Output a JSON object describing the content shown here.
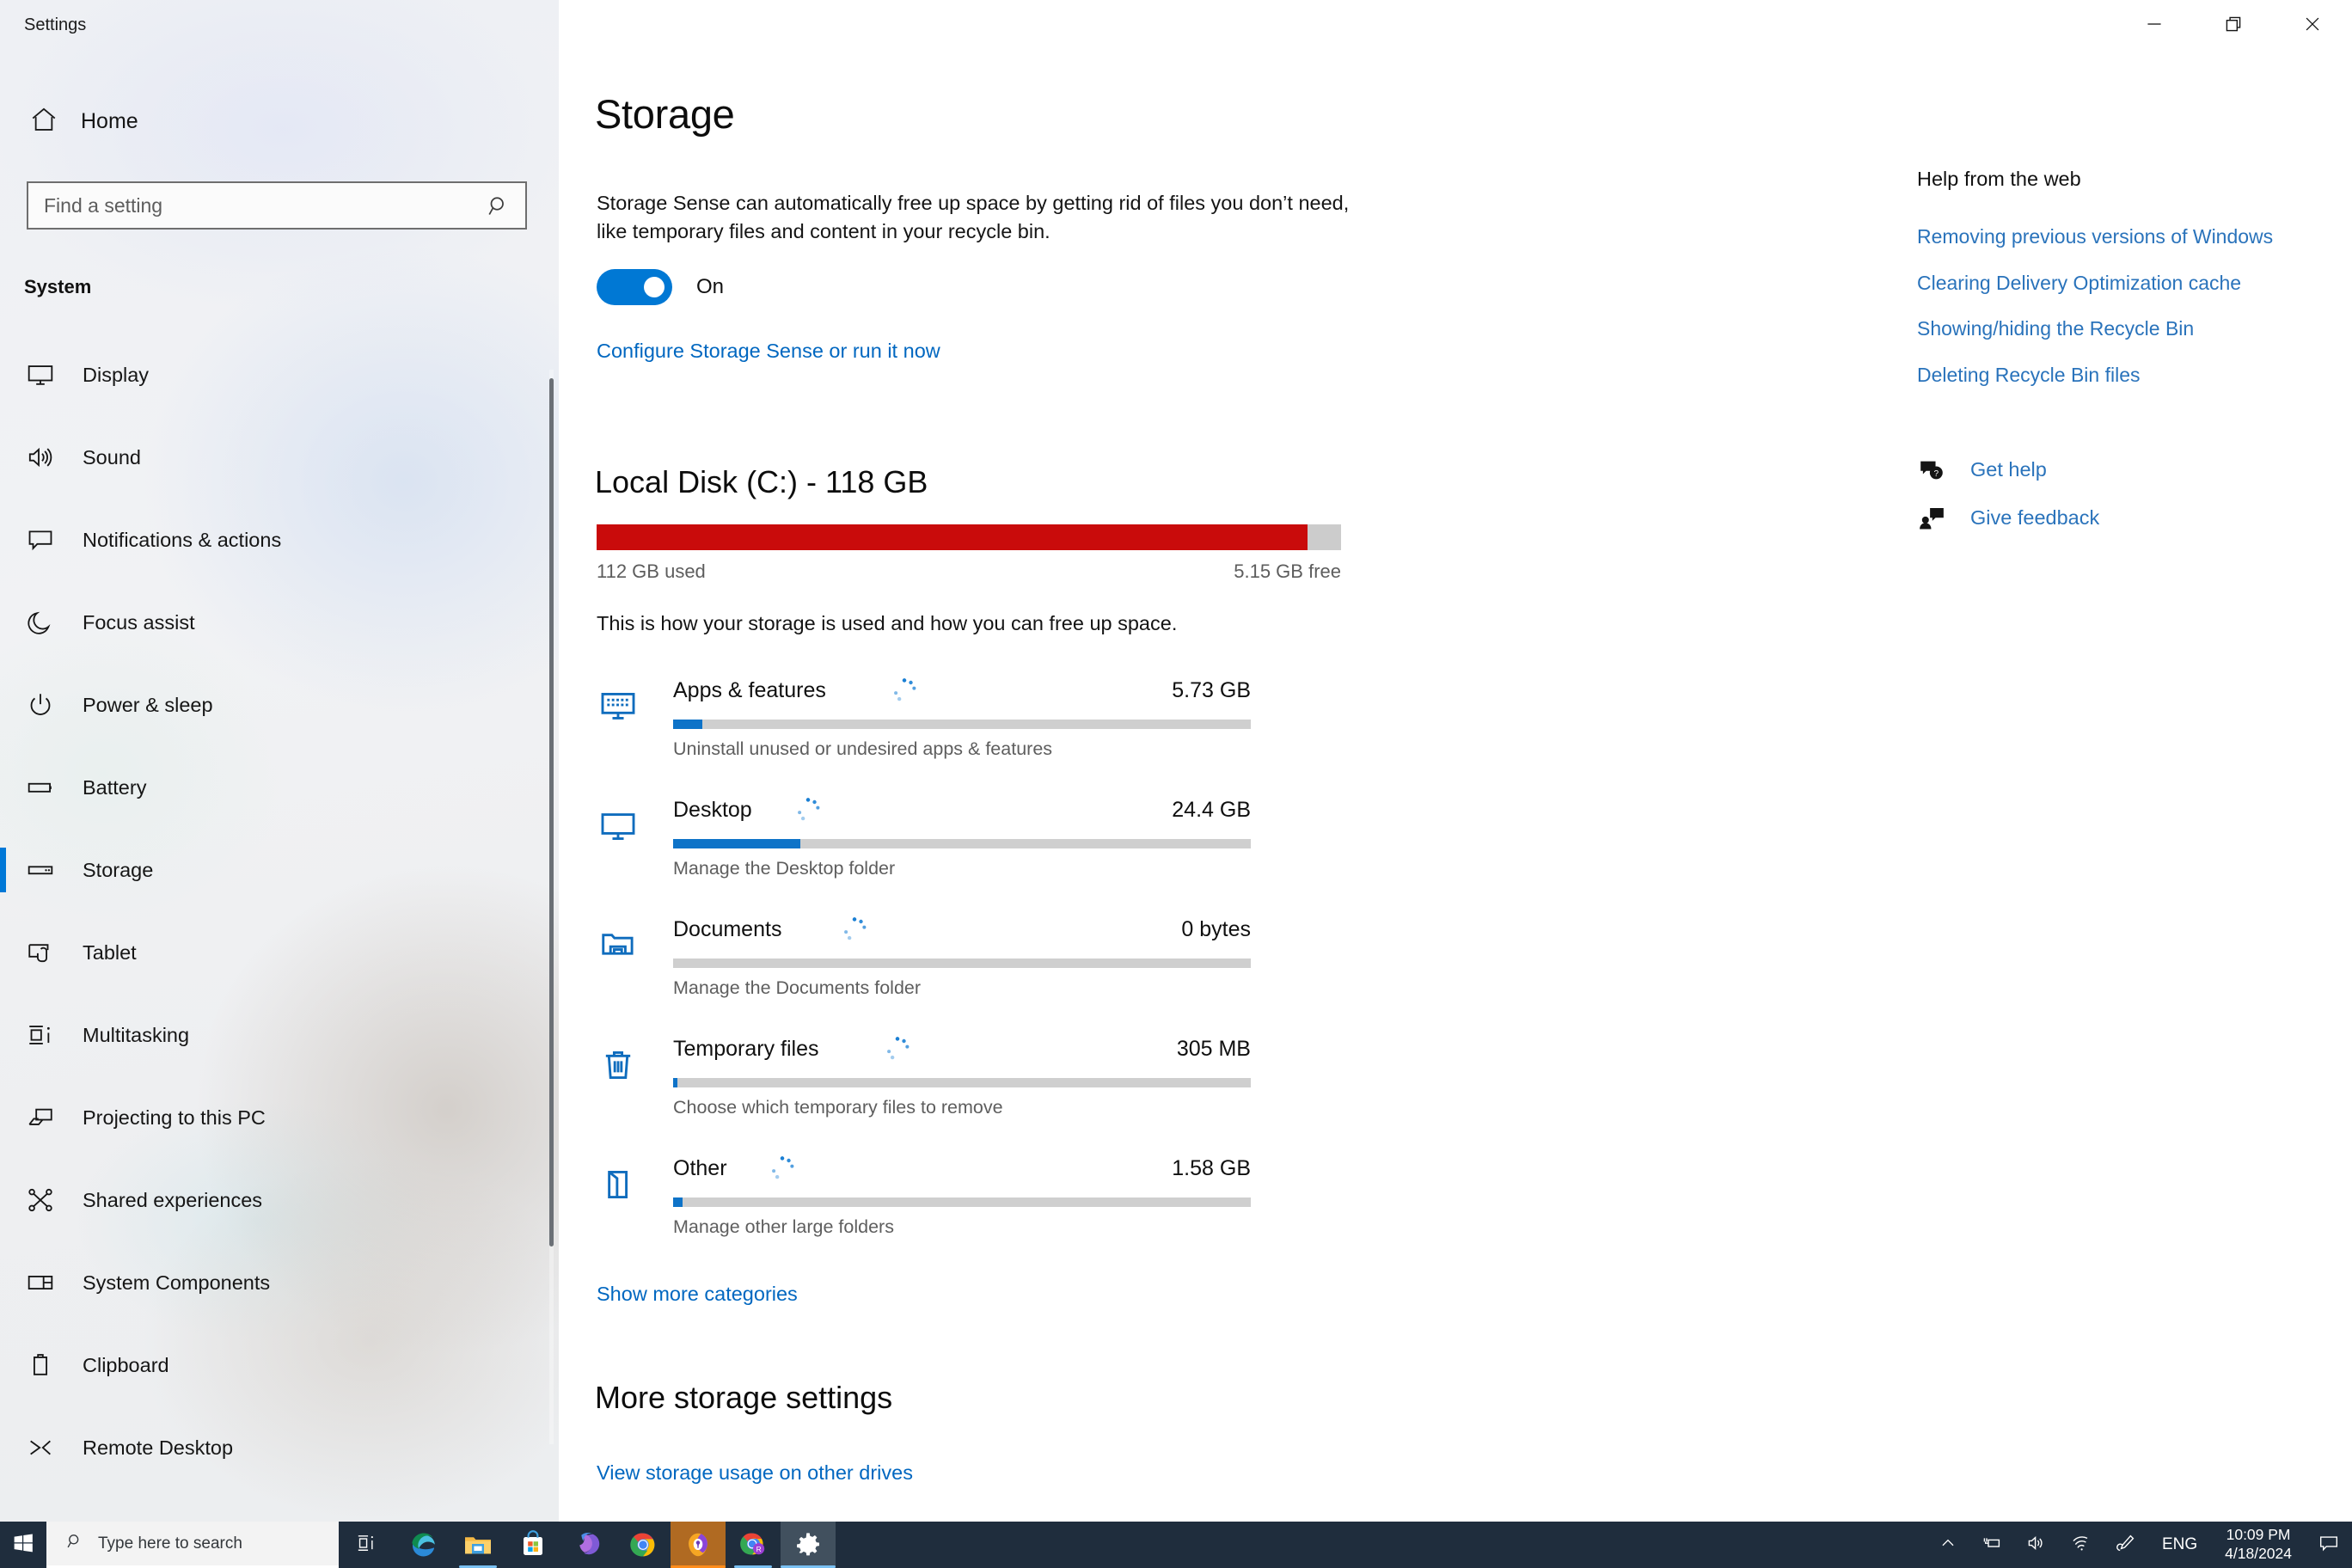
{
  "window": {
    "app_title": "Settings",
    "controls": [
      {
        "name": "minimize",
        "glyph": "minimize-icon"
      },
      {
        "name": "restore",
        "glyph": "restore-icon"
      },
      {
        "name": "close",
        "glyph": "close-icon"
      }
    ]
  },
  "nav": {
    "home_label": "Home",
    "home_icon": "home-icon",
    "search": {
      "placeholder": "Find a setting",
      "value": "",
      "icon": "search-icon"
    },
    "group_title": "System",
    "items": [
      {
        "label": "Display",
        "icon": "monitor-icon",
        "selected": false
      },
      {
        "label": "Sound",
        "icon": "speaker-icon",
        "selected": false
      },
      {
        "label": "Notifications & actions",
        "icon": "chat-bubble-icon",
        "selected": false
      },
      {
        "label": "Focus assist",
        "icon": "moon-icon",
        "selected": false
      },
      {
        "label": "Power & sleep",
        "icon": "power-icon",
        "selected": false
      },
      {
        "label": "Battery",
        "icon": "battery-icon",
        "selected": false
      },
      {
        "label": "Storage",
        "icon": "harddisk-icon",
        "selected": true
      },
      {
        "label": "Tablet",
        "icon": "tablet-touch-icon",
        "selected": false
      },
      {
        "label": "Multitasking",
        "icon": "multitasking-icon",
        "selected": false
      },
      {
        "label": "Projecting to this PC",
        "icon": "project-screen-icon",
        "selected": false
      },
      {
        "label": "Shared experiences",
        "icon": "share-nodes-icon",
        "selected": false
      },
      {
        "label": "System Components",
        "icon": "components-panel-icon",
        "selected": false
      },
      {
        "label": "Clipboard",
        "icon": "clipboard-icon",
        "selected": false
      },
      {
        "label": "Remote Desktop",
        "icon": "remote-desktop-icon",
        "selected": false
      }
    ]
  },
  "main": {
    "page_title": "Storage",
    "storage_sense": {
      "description": "Storage Sense can automatically free up space by getting rid of files you don’t need, like temporary files and content in your recycle bin.",
      "toggle_state": "On",
      "toggle_on": true,
      "configure_link": "Configure Storage Sense or run it now"
    },
    "disk": {
      "title": "Local Disk (C:) - 118 GB",
      "used_label": "112 GB used",
      "free_label": "5.15 GB free",
      "used_percent": 95.5,
      "hint": "This is how your storage is used and how you can free up space."
    },
    "categories": [
      {
        "name": "Apps & features",
        "size": "5.73 GB",
        "sub": "Uninstall unused or undesired apps & features",
        "icon": "apps-monitor-icon",
        "fill_percent": 5,
        "loading": true
      },
      {
        "name": "Desktop",
        "size": "24.4 GB",
        "sub": "Manage the Desktop folder",
        "icon": "desktop-monitor-icon",
        "fill_percent": 22,
        "loading": true
      },
      {
        "name": "Documents",
        "size": "0 bytes",
        "sub": "Manage the Documents folder",
        "icon": "documents-folder-icon",
        "fill_percent": 0,
        "loading": true
      },
      {
        "name": "Temporary files",
        "size": "305 MB",
        "sub": "Choose which temporary files to remove",
        "icon": "trash-bin-icon",
        "fill_percent": 0.7,
        "loading": true
      },
      {
        "name": "Other",
        "size": "1.58 GB",
        "sub": "Manage other large folders",
        "icon": "other-folder-icon",
        "fill_percent": 1.6,
        "loading": true
      }
    ],
    "show_more_label": "Show more categories",
    "more_settings_title": "More storage settings",
    "other_drives_link": "View storage usage on other drives"
  },
  "help": {
    "title": "Help from the web",
    "links": [
      "Removing previous versions of Windows",
      "Clearing Delivery Optimization cache",
      "Showing/hiding the Recycle Bin",
      "Deleting Recycle Bin files"
    ],
    "actions": [
      {
        "label": "Get help",
        "icon": "question-bubble-icon"
      },
      {
        "label": "Give feedback",
        "icon": "feedback-person-icon"
      }
    ]
  },
  "taskbar": {
    "start_icon": "windows-start-icon",
    "search": {
      "placeholder": "Type here to search",
      "icon": "search-icon"
    },
    "task_view_icon": "task-view-icon",
    "apps": [
      {
        "name": "microsoft-edge",
        "running": false
      },
      {
        "name": "file-explorer",
        "running": true
      },
      {
        "name": "microsoft-store",
        "running": false
      },
      {
        "name": "microsoft-office",
        "running": false
      },
      {
        "name": "google-chrome",
        "running": false
      },
      {
        "name": "password-manager",
        "running": true
      },
      {
        "name": "chrome-remote",
        "running": true
      },
      {
        "name": "settings",
        "running": true,
        "active": true
      }
    ],
    "tray": {
      "chevron_icon": "chevron-up-icon",
      "battery_icon": "battery-charging-icon",
      "volume_icon": "volume-icon",
      "network_icon": "wifi-icon",
      "pen_icon": "pen-icon",
      "language": "ENG",
      "time": "10:09 PM",
      "date": "4/18/2024",
      "notification_icon": "notification-icon"
    }
  },
  "colors": {
    "accent": "#0078d4",
    "link": "#0067c0",
    "disk_used": "#c90b0b",
    "disk_track": "#cccccc",
    "cat_fill": "#0e73c8",
    "taskbar_bg": "#1f2d3d",
    "icon_blue": "#0f6cbd"
  }
}
